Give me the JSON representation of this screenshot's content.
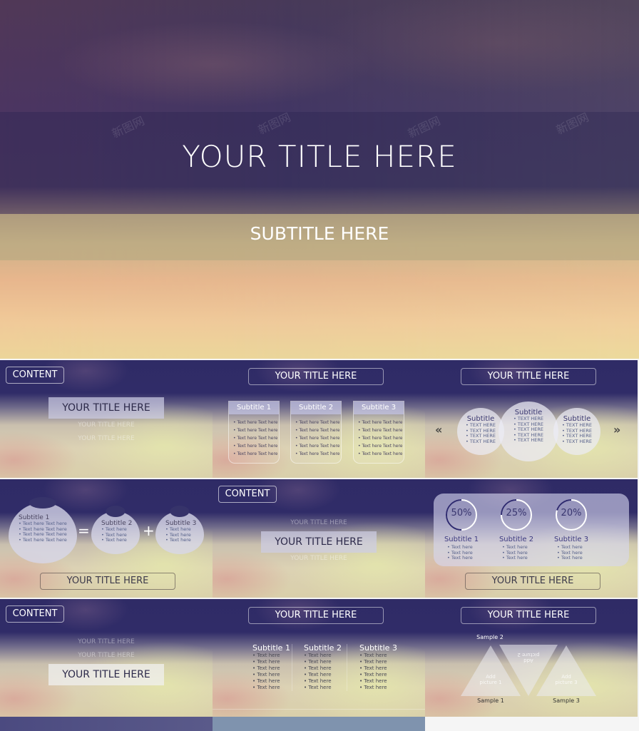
{
  "hero": {
    "title": "YOUR TITLE HERE",
    "subtitle": "SUBTITLE HERE",
    "watermark": "新图网"
  },
  "slides": {
    "s1": {
      "tag": "CONTENT",
      "title": "YOUR TITLE HERE",
      "ghost1": "YOUR TITLE HERE",
      "ghost2": "YOUR TITLE HERE"
    },
    "s2": {
      "title": "YOUR TITLE HERE",
      "cards": [
        {
          "subtitle": "Subtitle 1",
          "items": [
            "Text here Text here",
            "Text here Text here",
            "Text here Text here",
            "Text here Text here",
            "Text here Text here"
          ]
        },
        {
          "subtitle": "Subtitle 2",
          "items": [
            "Text here Text here",
            "Text here Text here",
            "Text here Text here",
            "Text here Text here",
            "Text here Text here"
          ]
        },
        {
          "subtitle": "Subtitle 3",
          "items": [
            "Text here Text here",
            "Text here Text here",
            "Text here Text here",
            "Text here Text here",
            "Text here Text here"
          ]
        }
      ]
    },
    "s3": {
      "title": "YOUR TITLE HERE",
      "prev": "«",
      "next": "»",
      "circles": [
        {
          "subtitle": "Subtitle",
          "items": [
            "TEXT HERE",
            "TEXT HERE",
            "TEXT HERE",
            "TEXT HERE"
          ]
        },
        {
          "subtitle": "Subtitle",
          "items": [
            "TEXT HERE",
            "TEXT HERE",
            "TEXT HERE",
            "TEXT HERE",
            "TEXT HERE"
          ]
        },
        {
          "subtitle": "Subtitle",
          "items": [
            "TEXT HERE",
            "TEXT HERE",
            "TEXT HERE",
            "TEXT HERE"
          ]
        }
      ]
    },
    "s4": {
      "title": "YOUR TITLE HERE",
      "equals": "=",
      "plus": "+",
      "petals": [
        {
          "subtitle": "Subtitle 1",
          "items": [
            "Text here Text here",
            "Text here Text here",
            "Text here Text here",
            "Text here Text here"
          ]
        },
        {
          "subtitle": "Subtitle 2",
          "items": [
            "Text here",
            "Text here",
            "Text here"
          ]
        },
        {
          "subtitle": "Subtitle 3",
          "items": [
            "Text here",
            "Text here",
            "Text here"
          ]
        }
      ]
    },
    "s5": {
      "tag": "CONTENT",
      "ghost1": "YOUR TITLE HERE",
      "title": "YOUR TITLE HERE",
      "ghost2": "YOUR TITLE HERE"
    },
    "s6": {
      "title": "YOUR TITLE HERE",
      "stats": [
        {
          "label": "50%",
          "percent": 50,
          "subtitle": "Subtitle 1",
          "items": [
            "Text here",
            "Text here",
            "Text here"
          ]
        },
        {
          "label": "25%",
          "percent": 25,
          "subtitle": "Subtitle 2",
          "items": [
            "Text here",
            "Text here",
            "Text here"
          ]
        },
        {
          "label": "20%",
          "percent": 20,
          "subtitle": "Subtitle 3",
          "items": [
            "Text here",
            "Text here",
            "Text here"
          ]
        }
      ]
    },
    "s7": {
      "tag": "CONTENT",
      "ghost1": "YOUR TITLE HERE",
      "ghost2": "YOUR TITLE HERE",
      "title": "YOUR TITLE HERE"
    },
    "s8": {
      "title": "YOUR TITLE HERE",
      "columns": [
        {
          "subtitle": "Subtitle 1",
          "items": [
            "Text here",
            "Text here",
            "Text here",
            "Text here",
            "Text here",
            "Text here"
          ]
        },
        {
          "subtitle": "Subtitle 2",
          "items": [
            "Text here",
            "Text here",
            "Text here",
            "Text here",
            "Text here",
            "Text here"
          ]
        },
        {
          "subtitle": "Subtitle 3",
          "items": [
            "Text here",
            "Text here",
            "Text here",
            "Text here",
            "Text here",
            "Text here"
          ]
        }
      ]
    },
    "s9": {
      "title": "YOUR TITLE HERE",
      "samples": [
        "Sample 1",
        "Sample 2",
        "Sample 3"
      ],
      "pictures": [
        "Add picture 1",
        "Add picture 2",
        "Add picture 3"
      ]
    }
  },
  "colors": {
    "navy": "#2f2b66",
    "ring_arc": "#2e2a70",
    "ring_base": "#ffffff",
    "strip_mid": "#7f93ae"
  }
}
